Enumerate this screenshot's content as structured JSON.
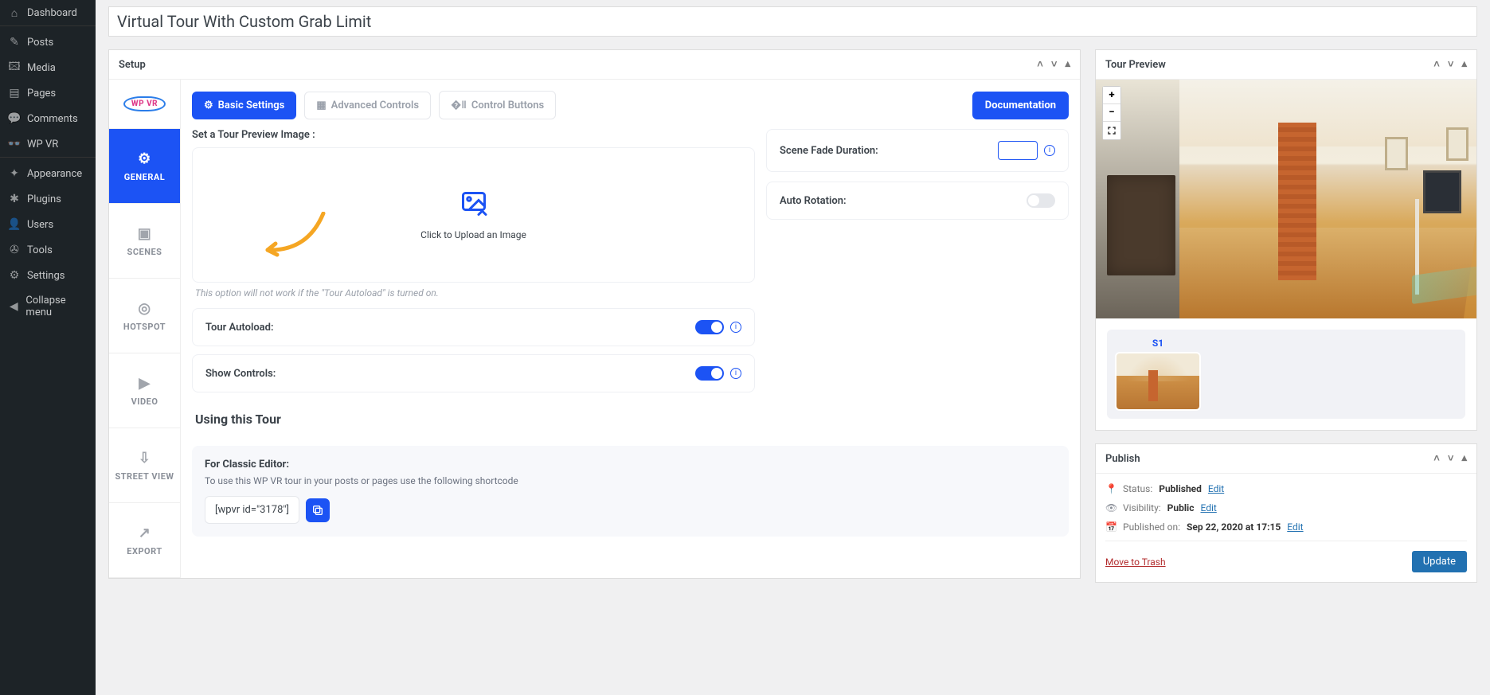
{
  "sidebar": {
    "items": [
      {
        "label": "Dashboard",
        "icon": "⌂"
      },
      {
        "label": "Posts",
        "icon": "✎"
      },
      {
        "label": "Media",
        "icon": "🖾"
      },
      {
        "label": "Pages",
        "icon": "▤"
      },
      {
        "label": "Comments",
        "icon": "💬"
      },
      {
        "label": "WP VR",
        "icon": "👓"
      },
      {
        "label": "Appearance",
        "icon": "✦"
      },
      {
        "label": "Plugins",
        "icon": "✱"
      },
      {
        "label": "Users",
        "icon": "👤"
      },
      {
        "label": "Tools",
        "icon": "✇"
      },
      {
        "label": "Settings",
        "icon": "⚙"
      },
      {
        "label": "Collapse menu",
        "icon": "◀"
      }
    ]
  },
  "title": "Virtual Tour With Custom Grab Limit",
  "setup": {
    "heading": "Setup",
    "logo_text": "WP VR",
    "vtabs": [
      {
        "label": "GENERAL",
        "icon": "⚙"
      },
      {
        "label": "SCENES",
        "icon": "▣"
      },
      {
        "label": "HOTSPOT",
        "icon": "◎"
      },
      {
        "label": "VIDEO",
        "icon": "▶"
      },
      {
        "label": "STREET VIEW",
        "icon": "⇩"
      },
      {
        "label": "EXPORT",
        "icon": "↗"
      }
    ],
    "tabs": {
      "basic": "Basic Settings",
      "advanced": "Advanced Controls",
      "control": "Control Buttons"
    },
    "documentation": "Documentation",
    "preview_label": "Set a Tour Preview Image :",
    "upload_text": "Click to Upload an Image",
    "upload_hint": "This option will not work if the \"Tour Autoload\" is turned on.",
    "autoload_label": "Tour Autoload:",
    "showcontrols_label": "Show Controls:",
    "fade_label": "Scene Fade Duration:",
    "rotation_label": "Auto Rotation:",
    "using_title": "Using this Tour",
    "classic_label": "For Classic Editor:",
    "classic_desc": "To use this WP VR tour in your posts or pages use the following shortcode",
    "shortcode": "[wpvr id=\"3178\"]"
  },
  "preview": {
    "heading": "Tour Preview",
    "zoom_in": "+",
    "zoom_out": "−",
    "thumb1": "S1"
  },
  "publish": {
    "heading": "Publish",
    "status_k": "Status:",
    "status_v": "Published",
    "vis_k": "Visibility:",
    "vis_v": "Public",
    "date_k": "Published on:",
    "date_v": "Sep 22, 2020 at 17:15",
    "edit": "Edit",
    "trash": "Move to Trash",
    "update": "Update"
  }
}
